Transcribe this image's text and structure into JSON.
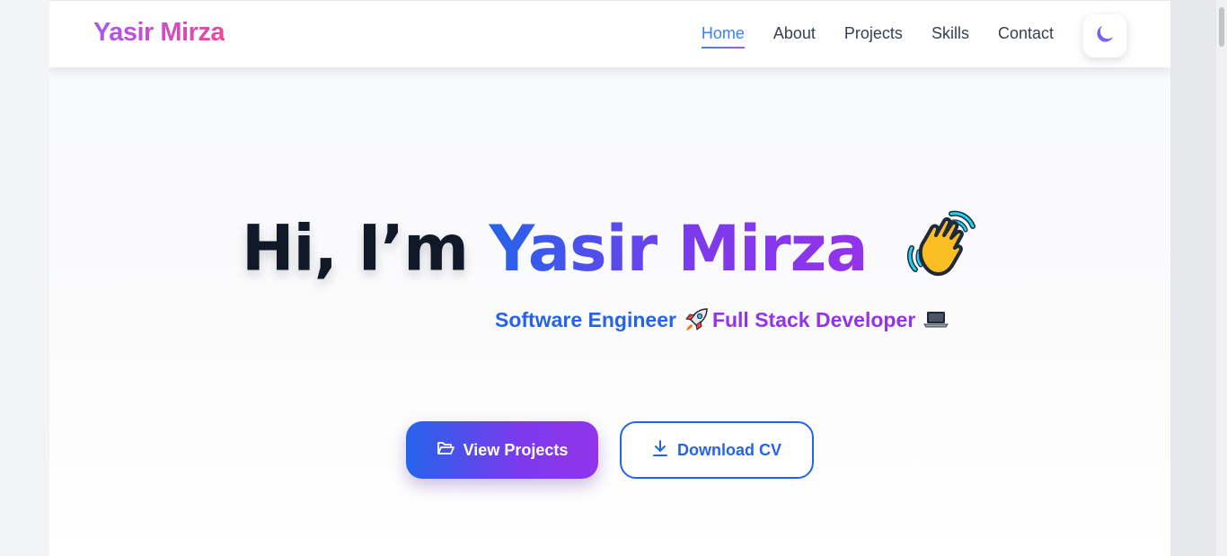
{
  "navbar": {
    "brand": "Yasir Mirza",
    "links": [
      {
        "label": "Home",
        "active": true
      },
      {
        "label": "About",
        "active": false
      },
      {
        "label": "Projects",
        "active": false
      },
      {
        "label": "Skills",
        "active": false
      },
      {
        "label": "Contact",
        "active": false
      }
    ],
    "theme_toggle_icon": "moon-icon"
  },
  "hero": {
    "greeting": "Hi, I’m",
    "name": "Yasir Mirza",
    "wave_icon": "waving-hand-icon",
    "subtitle_part1": "Software Engineer",
    "subtitle_part2": "Full Stack Developer",
    "rocket_icon": "rocket-icon",
    "laptop_icon": "laptop-icon"
  },
  "buttons": {
    "primary_label": "View Projects",
    "primary_icon": "folder-open-icon",
    "secondary_label": "Download CV",
    "secondary_icon": "download-icon"
  },
  "colors": {
    "brand_gradient": [
      "#a855f7",
      "#ec4899"
    ],
    "name_gradient": [
      "#2563eb",
      "#9333ea"
    ],
    "accent_blue": "#2563eb",
    "accent_purple": "#9333ea",
    "text_dark": "#111827"
  }
}
